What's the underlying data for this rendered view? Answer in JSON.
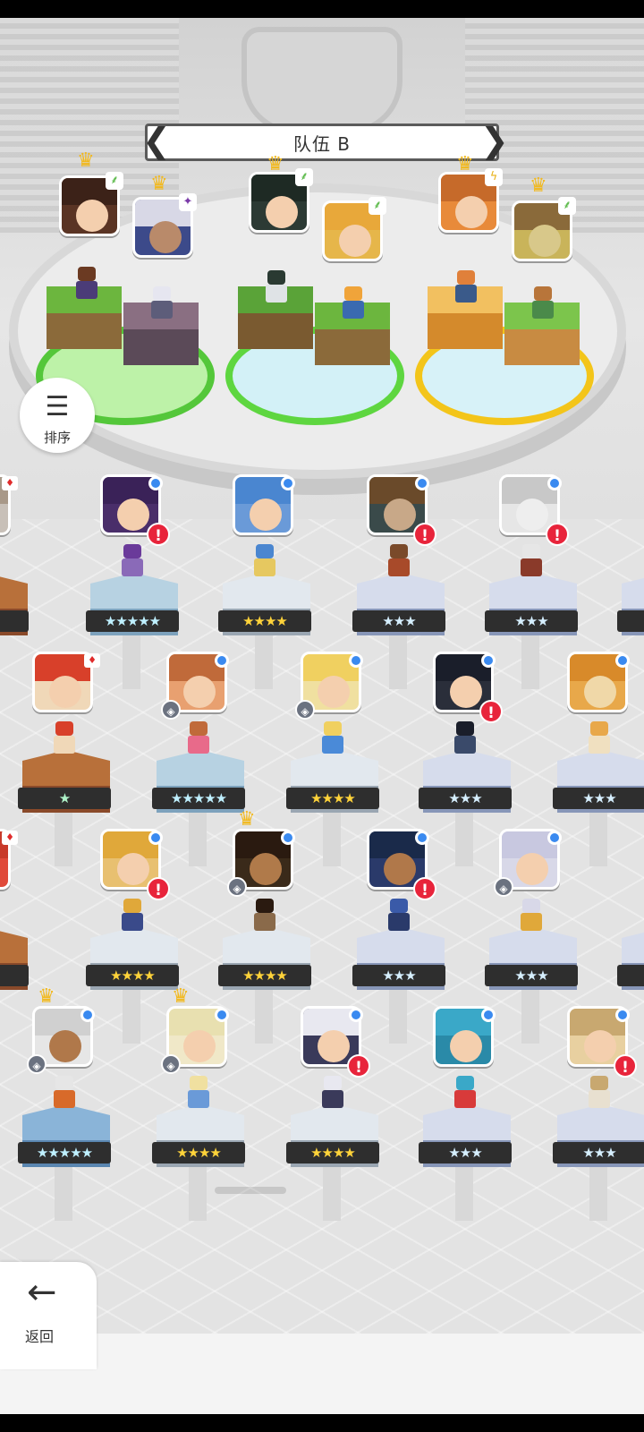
{
  "team": {
    "title": "队伍 B",
    "prev_arrow": "❮",
    "next_arrow": "❯"
  },
  "sort": {
    "label": "排序",
    "icon": "sort-icon"
  },
  "back": {
    "label": "返回",
    "icon": "arrow-left-icon"
  },
  "colors": {
    "ring_green": "#54c73a",
    "ring_gold": "#f3c51a",
    "alert": "#e8243b",
    "star_gold": "#ffd33a"
  },
  "team_slots": [
    {
      "crown": true,
      "element": "leaf"
    },
    {
      "crown": true,
      "element": "dark"
    },
    {
      "crown": true,
      "element": "leaf"
    },
    {
      "crown": false,
      "element": "leaf"
    },
    {
      "crown": true,
      "element": "thunder"
    },
    {
      "crown": true,
      "element": "leaf"
    }
  ],
  "roster": [
    {
      "stars": "★★★★★",
      "alert": "!"
    },
    {
      "stars": "★★★★",
      "alert": ""
    },
    {
      "stars": "★★★",
      "alert": "!"
    },
    {
      "stars": "★★★",
      "alert": "!"
    },
    {
      "stars": "★",
      "alert": ""
    },
    {
      "stars": "★★★★★",
      "alert": ""
    },
    {
      "stars": "★★★★",
      "alert": ""
    },
    {
      "stars": "★★★",
      "alert": "!"
    },
    {
      "stars": "★★★",
      "alert": ""
    },
    {
      "stars": "★★★★",
      "alert": "!"
    },
    {
      "stars": "★★★★",
      "alert": ""
    },
    {
      "stars": "★★★",
      "alert": "!"
    },
    {
      "stars": "★★★",
      "alert": ""
    },
    {
      "stars": "★★★★★",
      "alert": ""
    },
    {
      "stars": "★★★★",
      "alert": ""
    },
    {
      "stars": "★★★★",
      "alert": "!"
    },
    {
      "stars": "★★★",
      "alert": ""
    },
    {
      "stars": "★★★",
      "alert": "!"
    }
  ],
  "edge_roster": [
    {
      "stars": "★"
    },
    {
      "stars": "★★★"
    },
    {
      "stars": "★★★"
    },
    {
      "stars": "★"
    },
    {
      "stars": "★★★"
    }
  ]
}
